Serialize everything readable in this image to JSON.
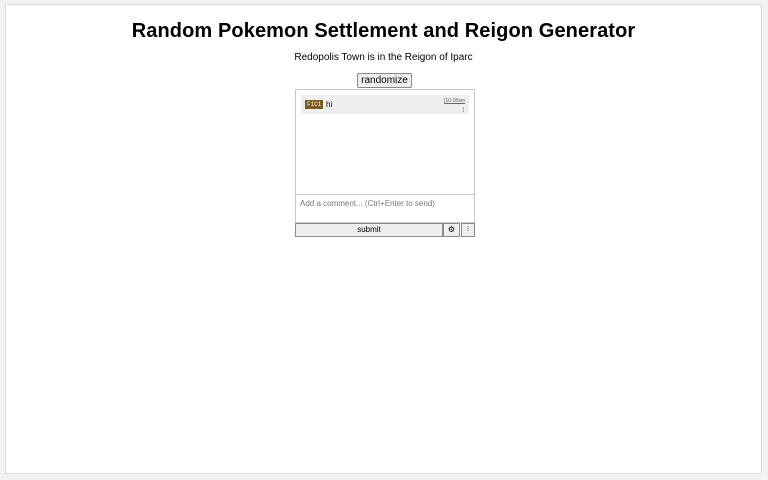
{
  "header": {
    "title": "Random Pokemon Settlement and Reigon Generator"
  },
  "result": {
    "text": "Redopolis Town is in the Reigon of Iparc"
  },
  "controls": {
    "randomize_label": "randomize"
  },
  "chat": {
    "messages": [
      {
        "user": "F1C1",
        "text": "hi",
        "time": "[10:28am",
        "more": "]"
      }
    ],
    "input": {
      "placeholder": "Add a comment... (Ctrl+Enter to send)",
      "value": ""
    },
    "submit_label": "submit",
    "settings_icon": "gear-icon",
    "settings_glyph": "⚙",
    "info_icon": "info-icon",
    "info_glyph": "⁝"
  },
  "colors": {
    "user_badge": "#7b5a24",
    "message_bg": "#efefef"
  }
}
